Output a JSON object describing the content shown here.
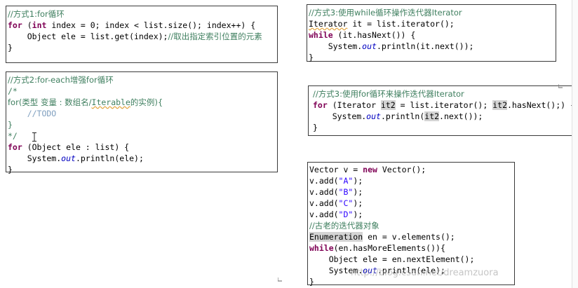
{
  "panels": {
    "p1": {
      "comment": "//方式1:for循环",
      "l2": [
        "for",
        " (",
        "int",
        " index = 0; index < list.size(); index++) {"
      ],
      "l3a": "    Object ele = list.get(index);",
      "l3b": "//取出指定索引位置的元素",
      "l4": "}"
    },
    "p2": {
      "comment": "//方式2:for-each增强for循环",
      "c2": "/*",
      "c3a": "for(类型 变量 : 数组名/",
      "c3b": "Iterable",
      "c3c": "的实例){",
      "c4": "    //TODO",
      "c5": "}",
      "c6": "*/",
      "l7a": "for",
      "l7b": " (Object ele : list) {",
      "l8a": "    System.",
      "l8b": "out",
      "l8c": ".println(ele);",
      "l9": "}"
    },
    "p3": {
      "comment": "//方式3:使用while循环操作迭代器Iterator",
      "l2a": "Iterator",
      "l2b": " it = list.iterator();",
      "l3a": "while",
      "l3b": " (it.hasNext()) {",
      "l4a": "    System.",
      "l4b": "out",
      "l4c": ".println(it.next());",
      "l5": "}"
    },
    "p4": {
      "comment": "//方式3:使用for循环来操作迭代器Iterator",
      "l2a": "for",
      "l2b": " (Iterator ",
      "l2c": "it2",
      "l2d": " = list.iterator(); ",
      "l2e": "it2",
      "l2f": ".hasNext();) {",
      "l3a": "    System.",
      "l3b": "out",
      "l3c": ".println(",
      "l3d": "it2",
      "l3e": ".next());",
      "l4": "}"
    },
    "p5": {
      "l1a": "Vector v = ",
      "l1b": "new",
      "l1c": " Vector();",
      "adds": [
        {
          "pre": "v.add(",
          "str": "\"A\"",
          "post": ");"
        },
        {
          "pre": "v.add(",
          "str": "\"B\"",
          "post": ");"
        },
        {
          "pre": "v.add(",
          "str": "\"C\"",
          "post": ");"
        },
        {
          "pre": "v.add(",
          "str": "\"D\"",
          "post": ");"
        }
      ],
      "comment": "//古老的迭代器对象",
      "l7a": "Enumeration",
      "l7b": " en = v.elements();",
      "l8a": "while",
      "l8b": "(en.hasMoreElements()){",
      "l9": "    Object ele = en.nextElement();",
      "l10a": "    System.",
      "l10b": "out",
      "l10c": ".println(ele);",
      "l11": "}"
    }
  },
  "watermark": "http://blog.csdn.net/dreamzuora",
  "colors": {
    "keyword": "#7f0055",
    "comment": "#3f7f5f",
    "string": "#2a00ff",
    "field": "#0000c0",
    "highlight": "#d4d4d4"
  }
}
